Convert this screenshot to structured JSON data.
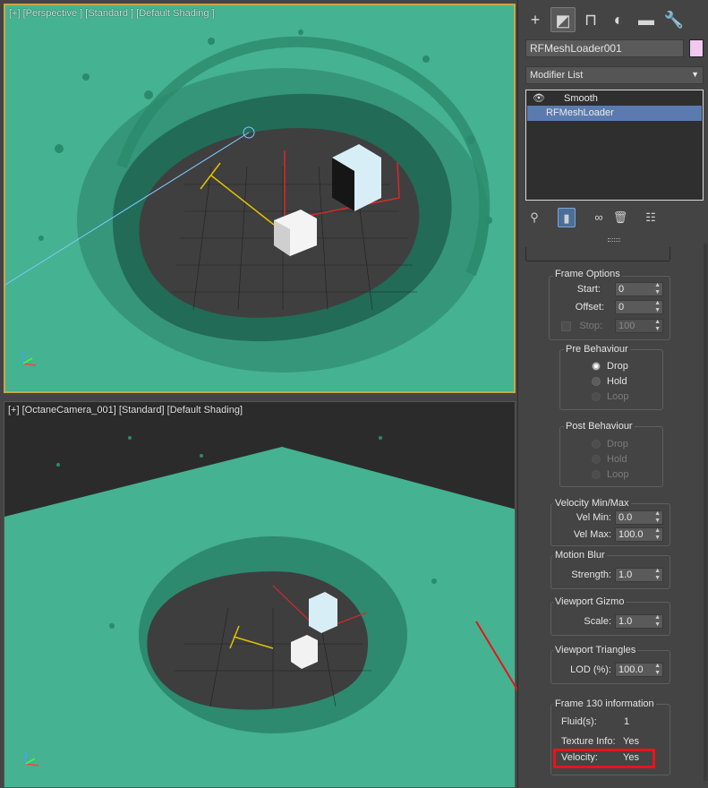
{
  "viewport_top": {
    "label": "[+] [Perspective ] [Standard ] [Default Shading ]"
  },
  "viewport_bottom": {
    "label": "[+] [OctaneCamera_001] [Standard] [Default Shading]"
  },
  "command_panel": {
    "tabs": [
      {
        "icon": "create-icon",
        "glyph": "+"
      },
      {
        "icon": "modify-icon",
        "glyph": "◩"
      },
      {
        "icon": "hierarchy-icon",
        "glyph": "⊓"
      },
      {
        "icon": "motion-icon",
        "glyph": "◐"
      },
      {
        "icon": "display-icon",
        "glyph": "▬"
      },
      {
        "icon": "utilities-icon",
        "glyph": "🔧"
      }
    ],
    "object_name": "RFMeshLoader001",
    "object_color": "#f0c8f0",
    "modifier_list_label": "Modifier List",
    "modifier_list_arrow": "▼",
    "stack": [
      {
        "label": "Smooth",
        "eye": "👁"
      },
      {
        "label": "RFMeshLoader"
      }
    ],
    "stack_tools": [
      {
        "icon": "pin-stack-icon",
        "glyph": "⚲"
      },
      {
        "icon": "show-end-result-icon",
        "glyph": "▮"
      },
      {
        "icon": "make-unique-icon",
        "glyph": "∞"
      },
      {
        "icon": "remove-modifier-icon",
        "glyph": "🗑"
      },
      {
        "icon": "configure-sets-icon",
        "glyph": "☷"
      }
    ]
  },
  "rollout": {
    "frame_options": {
      "title": "Frame Options",
      "start_label": "Start:",
      "start_value": "0",
      "offset_label": "Offset:",
      "offset_value": "0",
      "stop_label": "Stop:",
      "stop_value": "100"
    },
    "pre_behaviour": {
      "title": "Pre Behaviour",
      "options": [
        "Drop",
        "Hold",
        "Loop"
      ],
      "selected": "Drop"
    },
    "post_behaviour": {
      "title": "Post Behaviour",
      "options": [
        "Drop",
        "Hold",
        "Loop"
      ]
    },
    "velocity": {
      "title": "Velocity Min/Max",
      "min_label": "Vel Min:",
      "min_value": "0.0",
      "max_label": "Vel Max:",
      "max_value": "100.0"
    },
    "motion_blur": {
      "title": "Motion Blur",
      "strength_label": "Strength:",
      "strength_value": "1.0"
    },
    "viewport_gizmo": {
      "title": "Viewport Gizmo",
      "scale_label": "Scale:",
      "scale_value": "1.0"
    },
    "viewport_triangles": {
      "title": "Viewport Triangles",
      "lod_label": "LOD (%):",
      "lod_value": "100.0"
    },
    "frame_info": {
      "title": "Frame 130 information",
      "fluids_label": "Fluid(s):",
      "fluids_value": "1",
      "texture_label": "Texture Info:",
      "texture_value": "Yes",
      "velocity_label": "Velocity:",
      "velocity_value": "Yes"
    }
  },
  "colors": {
    "fluid": "#3fae8c",
    "highlight_box": "#e8141a",
    "selected_modifier": "#5b7bb0",
    "viewport_border_active": "#c9a64a"
  }
}
